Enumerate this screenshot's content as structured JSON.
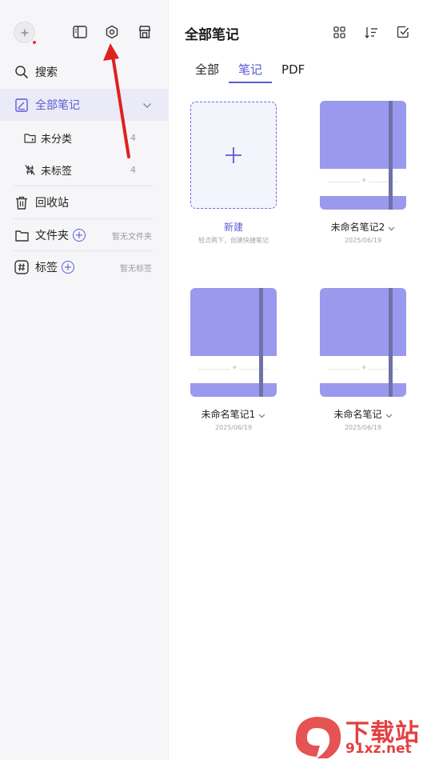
{
  "sidebar": {
    "search_label": "搜索",
    "all_notes_label": "全部笔记",
    "uncategorized": {
      "label": "未分类",
      "count": "4"
    },
    "untagged": {
      "label": "未标签",
      "count": "4"
    },
    "trash_label": "回收站",
    "folders": {
      "label": "文件夹",
      "empty_hint": "暂无文件夹"
    },
    "tags": {
      "label": "标签",
      "empty_hint": "暂无标签"
    }
  },
  "main": {
    "title": "全部笔记",
    "tabs": [
      {
        "label": "全部"
      },
      {
        "label": "笔记"
      },
      {
        "label": "PDF"
      }
    ],
    "new_card": {
      "title": "新建",
      "hint": "轻点两下，创建快捷笔记"
    },
    "notes": [
      {
        "title": "未命名笔记2",
        "date": "2025/06/19"
      },
      {
        "title": "未命名笔记1",
        "date": "2025/06/19"
      },
      {
        "title": "未命名笔记",
        "date": "2025/06/19"
      }
    ]
  },
  "colors": {
    "accent": "#5b5bd6",
    "notebook_cover": "#9999ee",
    "annotation_arrow": "#e02020"
  },
  "watermark": {
    "text": "下载站",
    "url": "91xz.net"
  }
}
